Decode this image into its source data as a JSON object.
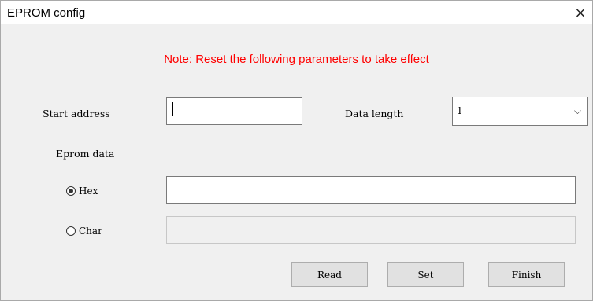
{
  "window": {
    "title": "EPROM config",
    "close_glyph": "×"
  },
  "note": "Note: Reset the following parameters to take effect",
  "start_address": {
    "label": "Start address",
    "value": ""
  },
  "data_length": {
    "label": "Data length",
    "selected": "1",
    "chevron_glyph": "⌵"
  },
  "eprom_data": {
    "label": "Eprom data",
    "hex": {
      "label": "Hex",
      "selected": true,
      "value": ""
    },
    "char": {
      "label": "Char",
      "selected": false,
      "value": ""
    }
  },
  "buttons": {
    "read": "Read",
    "set": "Set",
    "finish": "Finish"
  },
  "colors": {
    "note": "#ff0000",
    "window_bg": "#f0f0f0",
    "button_bg": "#e1e1e1"
  }
}
